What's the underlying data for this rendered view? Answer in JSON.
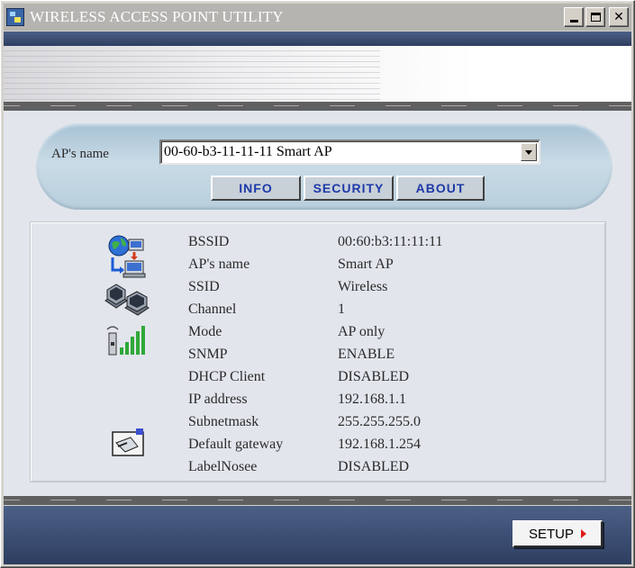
{
  "window": {
    "title": "WIRELESS ACCESS POINT UTILITY",
    "minimize_icon": "minimize-icon",
    "maximize_icon": "maximize-icon",
    "close_glyph": "✕"
  },
  "selector": {
    "label": "AP's name",
    "value": "00-60-b3-11-11-11 Smart AP"
  },
  "tabs": [
    {
      "label": "INFO"
    },
    {
      "label": "SECURITY"
    },
    {
      "label": "ABOUT"
    }
  ],
  "info": {
    "rows": [
      {
        "key": "BSSID",
        "value": "00:60:b3:11:11:11"
      },
      {
        "key": "AP's name",
        "value": "Smart AP"
      },
      {
        "key": "SSID",
        "value": "Wireless"
      },
      {
        "key": "Channel",
        "value": "1"
      },
      {
        "key": "Mode",
        "value": "AP only"
      },
      {
        "key": "SNMP",
        "value": "ENABLE"
      },
      {
        "key": "DHCP Client",
        "value": "DISABLED"
      },
      {
        "key": "IP address",
        "value": "192.168.1.1"
      },
      {
        "key": "Subnetmask",
        "value": "255.255.255.0"
      },
      {
        "key": "Default gateway",
        "value": "192.168.1.254"
      },
      {
        "key": "LabelNosee",
        "value": "DISABLED"
      }
    ],
    "icons": [
      "network-globe-icon",
      "computers-icon",
      "signal-strength-icon",
      "network-card-icon"
    ]
  },
  "footer": {
    "setup_label": "SETUP"
  },
  "colors": {
    "dark_bar": "#2d3e60",
    "tab_text": "#1e3aa8",
    "pill": "#b8cfdc",
    "setup_arrow": "#e01a1a"
  }
}
